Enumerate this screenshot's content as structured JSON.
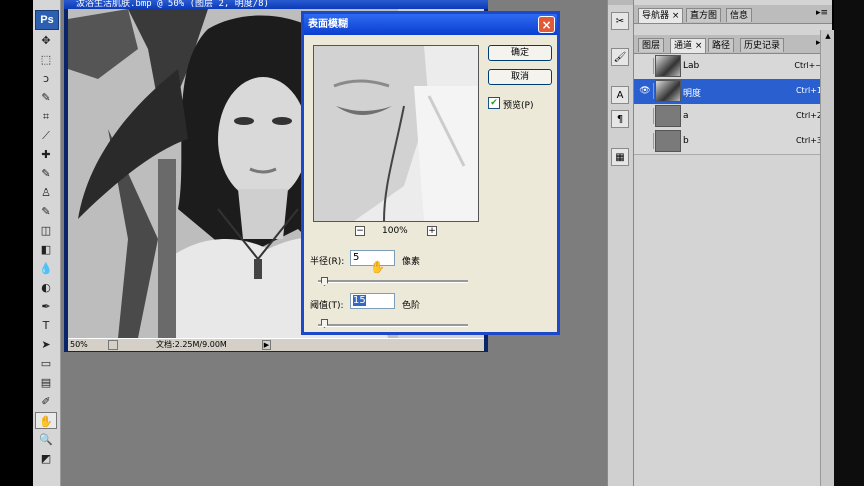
{
  "app": {
    "logo": "Ps"
  },
  "document": {
    "title": "沷浴生活肌肤.bmp @ 50% (图层 2, 明度/8)",
    "zoom": "50%",
    "doc_info": "文档:2.25M/9.00M"
  },
  "toolbox": {
    "tools": [
      "move-tool",
      "marquee-tool",
      "lasso-tool",
      "magic-wand-tool",
      "crop-tool",
      "slice-tool",
      "healing-brush-tool",
      "brush-tool",
      "clone-stamp-tool",
      "history-brush-tool",
      "eraser-tool",
      "gradient-tool",
      "blur-tool",
      "dodge-tool",
      "pen-tool",
      "type-tool",
      "path-selection-tool",
      "shape-tool",
      "notes-tool",
      "eyedropper-tool",
      "hand-tool",
      "zoom-tool",
      "color-swatch"
    ],
    "glyphs": [
      "✥",
      "⬚",
      "ↄ",
      "✎",
      "⌗",
      "⟋",
      "✚",
      "✎",
      "♙",
      "✎",
      "◫",
      "◧",
      "💧",
      "◐",
      "✒",
      "T",
      "➤",
      "▭",
      "▤",
      "✐",
      "✋",
      "🔍",
      "◩"
    ]
  },
  "dialog": {
    "title": "表面模糊",
    "ok_label": "确定",
    "cancel_label": "取消",
    "preview_label": "预览(P)",
    "preview_checked": true,
    "zoom_level": "100%",
    "zoom_out": "−",
    "zoom_in": "+",
    "radius_label": "半径(R):",
    "radius_value": "5",
    "radius_unit": "像素",
    "threshold_label": "阈值(T):",
    "threshold_value": "15",
    "threshold_unit": "色阶",
    "radius_slider": 0.02,
    "threshold_slider": 0.02
  },
  "panel_top": {
    "tabs": [
      "导航器",
      "直方图",
      "信息"
    ]
  },
  "panel_channels": {
    "tabs": [
      "图层",
      "通道",
      "路径",
      "历史记录"
    ],
    "active_tab": 1,
    "channels": [
      {
        "name": "Lab",
        "shortcut": "Ctrl+~",
        "visible": false,
        "selected": false
      },
      {
        "name": "明度",
        "shortcut": "Ctrl+1",
        "visible": true,
        "selected": true
      },
      {
        "name": "a",
        "shortcut": "Ctrl+2",
        "visible": false,
        "selected": false
      },
      {
        "name": "b",
        "shortcut": "Ctrl+3",
        "visible": false,
        "selected": false
      }
    ]
  },
  "dock": {
    "buttons": [
      "tool-presets-icon",
      "brushes-icon",
      "character-icon",
      "paragraph-icon",
      "layer-comps-icon"
    ],
    "glyphs": [
      "✂",
      "🖌",
      "A",
      "¶",
      "▦"
    ]
  },
  "colors": {
    "selection": "#2a5fcf",
    "titlebar": "#0b3fd0",
    "workspace": "#7d7d7d"
  }
}
